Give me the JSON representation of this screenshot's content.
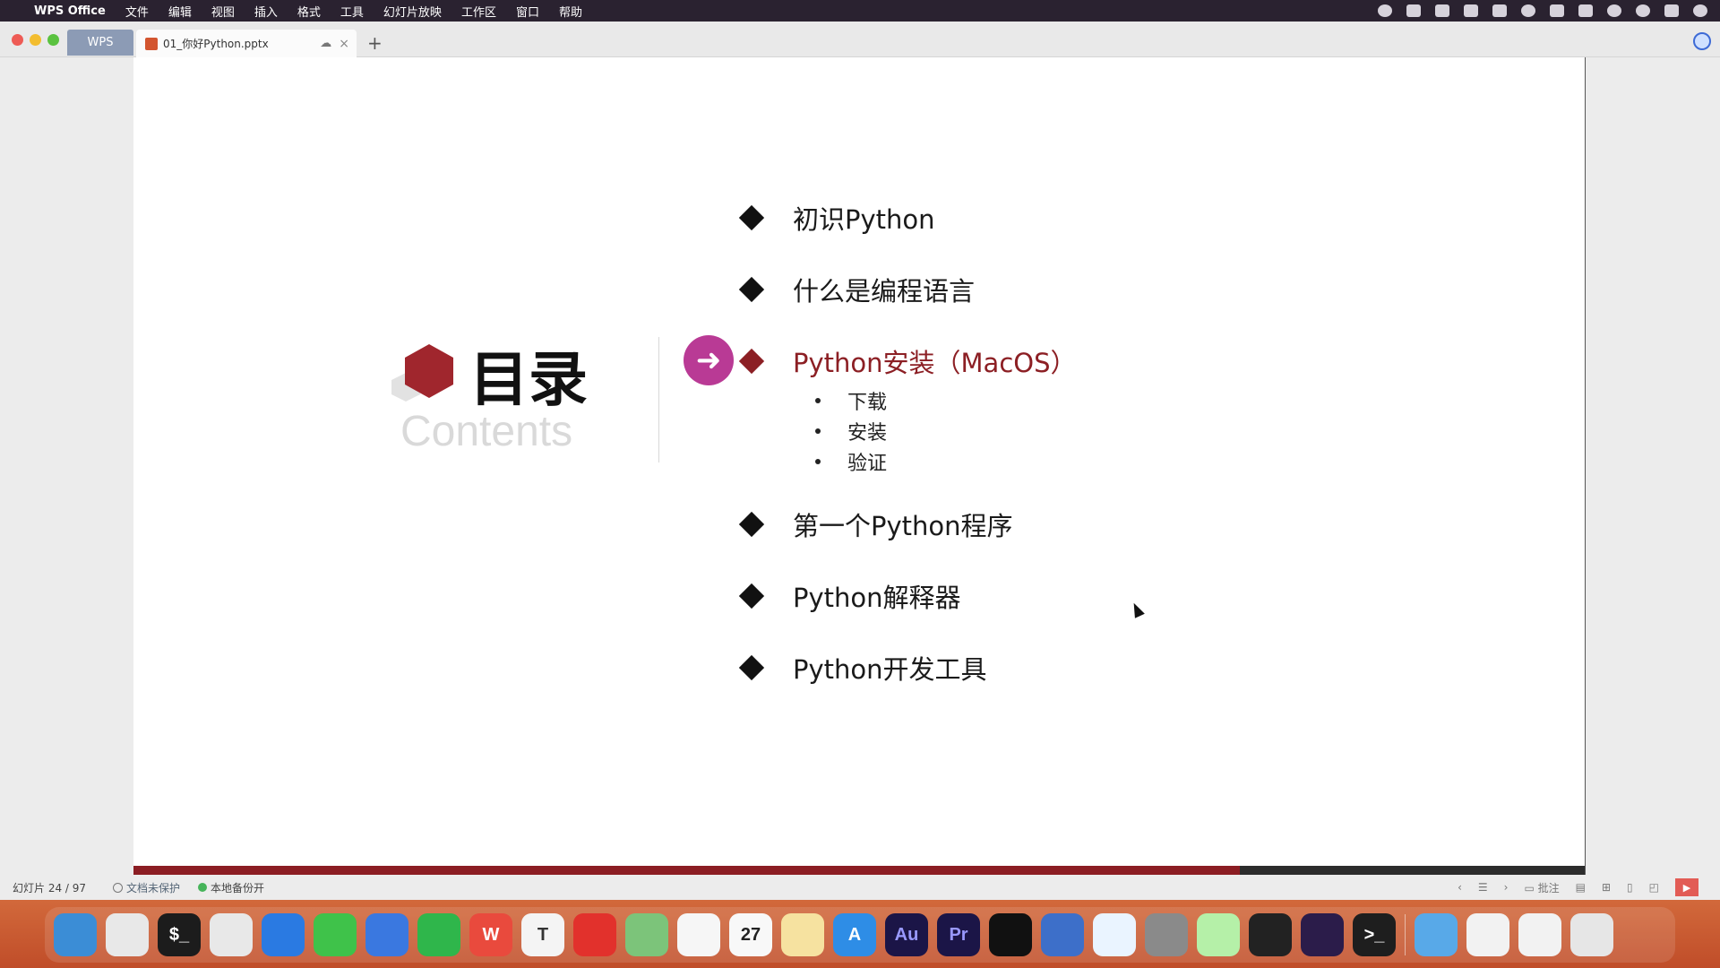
{
  "menubar": {
    "app_name": "WPS Office",
    "items": [
      "文件",
      "编辑",
      "视图",
      "插入",
      "格式",
      "工具",
      "幻灯片放映",
      "工作区",
      "窗口",
      "帮助"
    ]
  },
  "tabs": {
    "home_label": "WPS",
    "document_label": "01_你好Python.pptx",
    "new_tab_label": "+"
  },
  "slide": {
    "title": "目录",
    "subtitle": "Contents",
    "items": [
      {
        "label": "初识Python"
      },
      {
        "label": "什么是编程语言"
      },
      {
        "label": "Python安装（MacOS）",
        "active": true
      },
      {
        "label": "第一个Python程序"
      },
      {
        "label": "Python解释器"
      },
      {
        "label": "Python开发工具"
      }
    ],
    "subitems": [
      "下载",
      "安装",
      "验证"
    ],
    "accent_color": "#8c1f24",
    "arrow_color": "#b93a95"
  },
  "progress": {
    "current": 24,
    "total": 97
  },
  "status": {
    "slide_counter": "幻灯片 24 / 97",
    "protection": "文档未保护",
    "backup": "本地备份开",
    "annotate": "批注"
  },
  "dock": {
    "icons": [
      {
        "name": "finder-icon",
        "label": ""
      },
      {
        "name": "launchpad-icon",
        "label": ""
      },
      {
        "name": "terminal-icon",
        "label": "$_"
      },
      {
        "name": "chrome-icon",
        "label": ""
      },
      {
        "name": "safari-icon",
        "label": ""
      },
      {
        "name": "messages-icon",
        "label": ""
      },
      {
        "name": "quicktime-icon",
        "label": ""
      },
      {
        "name": "wechat-icon",
        "label": ""
      },
      {
        "name": "wps-icon",
        "label": "W"
      },
      {
        "name": "typora-icon",
        "label": "T"
      },
      {
        "name": "sound-icon",
        "label": ""
      },
      {
        "name": "maps-icon",
        "label": ""
      },
      {
        "name": "photos-icon",
        "label": ""
      },
      {
        "name": "calendar-icon",
        "label": "27"
      },
      {
        "name": "notes-icon",
        "label": ""
      },
      {
        "name": "app-store-icon",
        "label": "A"
      },
      {
        "name": "audition-icon",
        "label": "Au"
      },
      {
        "name": "premiere-icon",
        "label": "Pr"
      },
      {
        "name": "capcut-icon",
        "label": ""
      },
      {
        "name": "screen-icon",
        "label": ""
      },
      {
        "name": "baidu-netdisk-icon",
        "label": ""
      },
      {
        "name": "system-settings-icon",
        "label": ""
      },
      {
        "name": "pycharm-icon",
        "label": ""
      },
      {
        "name": "device-icon",
        "label": ""
      },
      {
        "name": "screen-record-icon",
        "label": ""
      },
      {
        "name": "terminal2-icon",
        "label": ">_"
      },
      {
        "name": "folder-icon",
        "label": ""
      },
      {
        "name": "preview-window-icon",
        "label": ""
      },
      {
        "name": "preview-window2-icon",
        "label": ""
      },
      {
        "name": "trash-icon",
        "label": ""
      }
    ]
  }
}
